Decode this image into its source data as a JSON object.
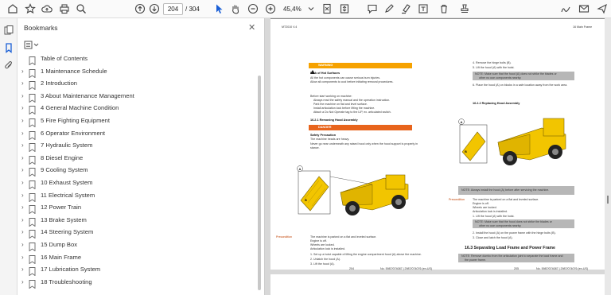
{
  "toolbar": {
    "page_current": "204",
    "page_total": "/ 304",
    "zoom": "45,4%"
  },
  "bookmarks_panel": {
    "title": "Bookmarks",
    "items": [
      {
        "label": "Table of Contents",
        "expandable": false
      },
      {
        "label": "1 Maintenance Schedule",
        "expandable": true
      },
      {
        "label": "2 Introduction",
        "expandable": true
      },
      {
        "label": "3 About Maintenance Management",
        "expandable": true
      },
      {
        "label": "4 General Machine Condition",
        "expandable": true
      },
      {
        "label": "5 Fire Fighting Equipment",
        "expandable": true
      },
      {
        "label": "6 Operator Environment",
        "expandable": true
      },
      {
        "label": "7 Hydraulic System",
        "expandable": true
      },
      {
        "label": "8 Diesel Engine",
        "expandable": true
      },
      {
        "label": "9 Cooling System",
        "expandable": true
      },
      {
        "label": "10 Exhaust System",
        "expandable": true
      },
      {
        "label": "11 Electrical System",
        "expandable": true
      },
      {
        "label": "12 Power Train",
        "expandable": true
      },
      {
        "label": "13 Brake System",
        "expandable": true
      },
      {
        "label": "14 Steering System",
        "expandable": true
      },
      {
        "label": "15 Dump Box",
        "expandable": true
      },
      {
        "label": "16 Main Frame",
        "expandable": true
      },
      {
        "label": "17 Lubrication System",
        "expandable": true
      },
      {
        "label": "18 Troubleshooting",
        "expandable": true
      }
    ]
  },
  "document": {
    "left_header": "MT2010 V.4",
    "right_header": "16 Main Frame",
    "warning_label": "WARNING",
    "warning_title": "Risk of Hot Surfaces",
    "warning_text_1": "All the hot components can cause serious burn injuries.",
    "warning_text_2": "Allow all components to cool before initiating removal procedures.",
    "before_text": "Before start working on machine:",
    "bullet_1": "Always read the safety manual and the operation instruction.",
    "bullet_2": "Park the machine on flat and level surface.",
    "bullet_3": "Install articulation lock before lifting the machine.",
    "bullet_4": "Attach a Do Not Operate tag to the LIP, ex. articulated switch.",
    "section_removing": "16.2.1 Removing Hood Assembly",
    "danger_label": "DANGER",
    "danger_title": "Safety Precaution",
    "danger_text_1": "The machine heads are heavy.",
    "danger_text_2": "Never go near underneath any raised hood only when the hood support is properly in",
    "danger_text_3": "stance.",
    "precondition": "Precondition",
    "pre_1": "The machine is parked on a flat and leveled surface.",
    "pre_2": "Engine is off.",
    "pre_3": "Wheels are locked.",
    "pre_4": "Articulation lock is installed.",
    "step_1": "1.   Set up a hoist capable of lifting the engine compartment hood (A) above the machine.",
    "step_2": "2.   Unlatch the hood (A).",
    "step_3": "3.   Lift the hood (A).",
    "page_left_num": "204",
    "page_left_doc": "No. 5987/074087 | 2987/074076 (en-US)",
    "r_step_4": "4.   Remove the hinge bolts (B).",
    "r_step_5": "5.   Lift the hood (A) with the hoist.",
    "r_note_1": "NOTE: Make sure that the hood (A) does not strike the blades or",
    "r_note_1b": "other no use components nearby.",
    "r_step_6": "6.   Place the hood (A) on blocks in a safe location away from the work area.",
    "section_replacing": "16.2.2 Replacing Hood Assembly",
    "r_note_2": "NOTE: Always install the hood (A) before after servicing the machine.",
    "r_pre_1": "The machine is parked on a flat and leveled surface.",
    "r_pre_2": "Engine is off.",
    "r_pre_3": "Wheels are locked.",
    "r_pre_4": "Articulation lock is installed.",
    "r_step_1": "1.   Lift the hood (A) with the hoist.",
    "r_note_3": "NOTE: Make sure that the hood does not strike the blades or",
    "r_note_3b": "other no use components nearby.",
    "r_step_2": "2.   Install the hood (A) on the power frame with the hinge bolts (B).",
    "r_step_3": "3.   Close and latch the hood (A).",
    "section_separating": "16.3  Separating Load Frame and Power Frame",
    "r_note_4": "NOTE: Remove dumbo from the articulation joint to separate the load frame and",
    "r_note_4b": "the power frame.",
    "page_right_num": "205",
    "page_right_doc": "No. 5987/074087 | 2987/074076 (en-US)",
    "label_a": "A",
    "label_b": "B"
  },
  "colors": {
    "machine_yellow": "#f2c500",
    "warning_orange": "#f6a200",
    "danger_orange": "#e8641c",
    "note_gray": "#b7b7b7",
    "tool_blue": "#1a5fd6"
  }
}
